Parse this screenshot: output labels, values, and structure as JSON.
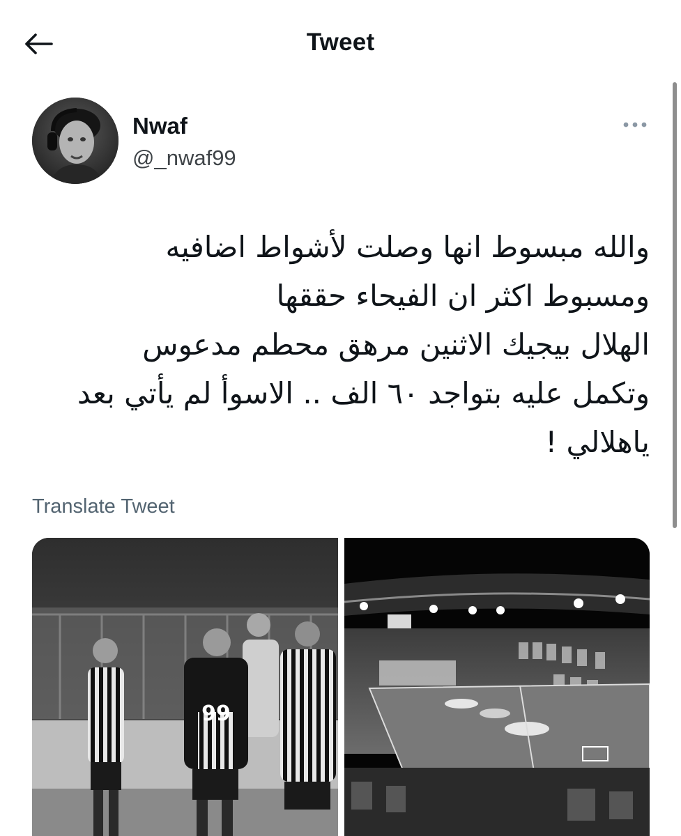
{
  "header": {
    "title": "Tweet",
    "back_icon": "arrow-left-icon"
  },
  "author": {
    "name": "Nwaf",
    "handle": "@_nwaf99"
  },
  "more_icon": "ellipsis-icon",
  "tweet": {
    "lines": [
      "والله مبسوط انها وصلت لأشواط اضافيه",
      "ومسبوط اكثر ان الفيحاء حققها",
      "الهلال بيجيك الاثنين مرهق محطم مدعوس",
      "وتكمل عليه بتواجد ٦٠ الف .. الاسوأ لم يأتي بعد",
      "ياهلالي !"
    ]
  },
  "translate_label": "Translate Tweet",
  "media": {
    "player_number": "99"
  },
  "colors": {
    "text": "#0f1419",
    "secondary": "#536471"
  }
}
